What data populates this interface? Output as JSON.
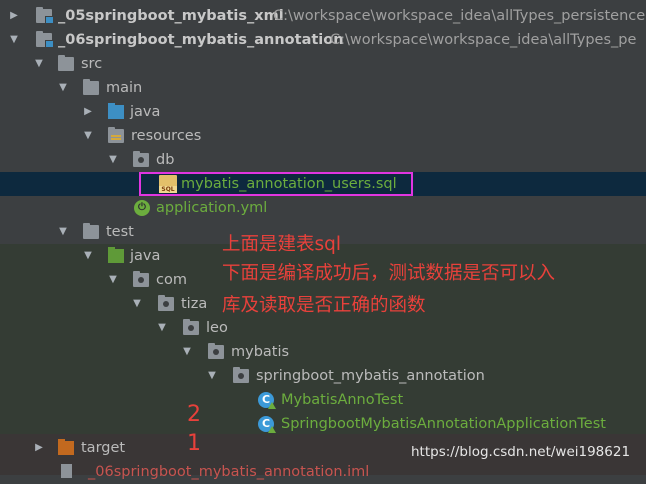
{
  "tree": {
    "module_05": {
      "name": "_05springboot_mybatis_xml",
      "path": "C:\\workspace\\workspace_idea\\allTypes_persistence"
    },
    "module_06": {
      "name": "_06springboot_mybatis_annotation",
      "path": "C:\\workspace\\workspace_idea\\allTypes_pe"
    },
    "src": "src",
    "main": "main",
    "java_main": "java",
    "resources": "resources",
    "db": "db",
    "sql_file": "mybatis_annotation_users.sql",
    "application_yml": "application.yml",
    "test": "test",
    "java_test": "java",
    "com": "com",
    "tiza": "tiza",
    "leo": "leo",
    "mybatis": "mybatis",
    "pkg": "springboot_mybatis_annotation",
    "class_1": "MybatisAnnoTest",
    "class_2": "SpringbootMybatisAnnotationApplicationTest",
    "target": "target",
    "iml": "_06springboot_mybatis_annotation.iml"
  },
  "annotations": {
    "line1": "上面是建表sql",
    "line2": "下面是编译成功后，测试数据是否可以入",
    "line3": "库及读取是否正确的函数",
    "num2": "2",
    "num1": "1"
  },
  "watermark": "https://blog.csdn.net/wei198621",
  "colors": {
    "background": "#3c3f41",
    "selection": "#0d293e",
    "annotation_red": "#e8413b",
    "highlight_box": "#e135e1",
    "spring_green": "#6cad3e"
  }
}
